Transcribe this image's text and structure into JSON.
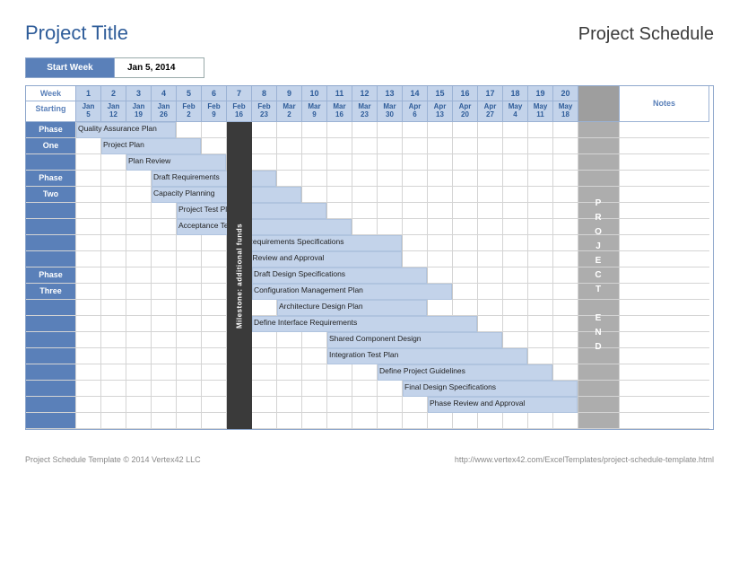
{
  "title": "Project Title",
  "subhead": "Project Schedule",
  "start_week_label": "Start Week",
  "start_week_value": "Jan 5, 2014",
  "header": {
    "week_label": "Week",
    "starting_label": "Starting",
    "notes_label": "Notes",
    "weeks": [
      1,
      2,
      3,
      4,
      5,
      6,
      7,
      8,
      9,
      10,
      11,
      12,
      13,
      14,
      15,
      16,
      17,
      18,
      19,
      20
    ],
    "dates": [
      "Jan 5",
      "Jan 12",
      "Jan 19",
      "Jan 26",
      "Feb 2",
      "Feb 9",
      "Feb 16",
      "Feb 23",
      "Mar 2",
      "Mar 9",
      "Mar 16",
      "Mar 23",
      "Mar 30",
      "Apr 6",
      "Apr 13",
      "Apr 20",
      "Apr 27",
      "May 4",
      "May 11",
      "May 18"
    ]
  },
  "phases": [
    {
      "name": "Phase One",
      "row_start": 0,
      "row_span": 3
    },
    {
      "name": "Phase Two",
      "row_start": 3,
      "row_span": 6
    },
    {
      "name": "Phase Three",
      "row_start": 9,
      "row_span": 10
    }
  ],
  "tasks": [
    {
      "row": 0,
      "start": 1,
      "span": 4,
      "label": "Quality Assurance Plan"
    },
    {
      "row": 1,
      "start": 2,
      "span": 4,
      "label": "Project Plan"
    },
    {
      "row": 2,
      "start": 3,
      "span": 4,
      "label": "Plan Review"
    },
    {
      "row": 3,
      "start": 4,
      "span": 5,
      "label": "Draft Requirements"
    },
    {
      "row": 4,
      "start": 4,
      "span": 6,
      "label": "Capacity Planning"
    },
    {
      "row": 5,
      "start": 5,
      "span": 6,
      "label": "Project Test Plan"
    },
    {
      "row": 6,
      "start": 5,
      "span": 7,
      "label": "Acceptance Test Plan"
    },
    {
      "row": 7,
      "start": 7,
      "span": 7,
      "label": "Final Requirements Specifications"
    },
    {
      "row": 8,
      "start": 7,
      "span": 7,
      "label": "Phase Review and Approval"
    },
    {
      "row": 9,
      "start": 8,
      "span": 7,
      "label": "Draft Design Specifications"
    },
    {
      "row": 10,
      "start": 8,
      "span": 8,
      "label": "Configuration Management Plan"
    },
    {
      "row": 11,
      "start": 9,
      "span": 6,
      "label": "Architecture Design Plan"
    },
    {
      "row": 12,
      "start": 8,
      "span": 9,
      "label": "Define Interface Requirements"
    },
    {
      "row": 13,
      "start": 11,
      "span": 7,
      "label": "Shared Component Design"
    },
    {
      "row": 14,
      "start": 11,
      "span": 8,
      "label": "Integration Test Plan"
    },
    {
      "row": 15,
      "start": 13,
      "span": 7,
      "label": "Define Project Guidelines"
    },
    {
      "row": 16,
      "start": 14,
      "span": 7,
      "label": "Final Design Specifications"
    },
    {
      "row": 17,
      "start": 15,
      "span": 6,
      "label": "Phase Review and Approval"
    }
  ],
  "milestone": {
    "label": "Milestone: additional funds",
    "col": 7,
    "row_start": 0,
    "row_span": 19
  },
  "project_end": "PROJECT END",
  "total_rows": 19,
  "footer_left": "Project Schedule Template © 2014 Vertex42 LLC",
  "footer_right": "http://www.vertex42.com/ExcelTemplates/project-schedule-template.html",
  "chart_data": {
    "type": "gantt",
    "title": "Project Schedule",
    "start_date": "Jan 5, 2014",
    "weeks": 20,
    "x_labels": [
      "Jan 5",
      "Jan 12",
      "Jan 19",
      "Jan 26",
      "Feb 2",
      "Feb 9",
      "Feb 16",
      "Feb 23",
      "Mar 2",
      "Mar 9",
      "Mar 16",
      "Mar 23",
      "Mar 30",
      "Apr 6",
      "Apr 13",
      "Apr 20",
      "Apr 27",
      "May 4",
      "May 11",
      "May 18"
    ],
    "series": [
      {
        "phase": "Phase One",
        "task": "Quality Assurance Plan",
        "start_week": 1,
        "duration_weeks": 4
      },
      {
        "phase": "Phase One",
        "task": "Project Plan",
        "start_week": 2,
        "duration_weeks": 4
      },
      {
        "phase": "Phase One",
        "task": "Plan Review",
        "start_week": 3,
        "duration_weeks": 4
      },
      {
        "phase": "Phase Two",
        "task": "Draft Requirements",
        "start_week": 4,
        "duration_weeks": 5
      },
      {
        "phase": "Phase Two",
        "task": "Capacity Planning",
        "start_week": 4,
        "duration_weeks": 6
      },
      {
        "phase": "Phase Two",
        "task": "Project Test Plan",
        "start_week": 5,
        "duration_weeks": 6
      },
      {
        "phase": "Phase Two",
        "task": "Acceptance Test Plan",
        "start_week": 5,
        "duration_weeks": 7
      },
      {
        "phase": "Phase Two",
        "task": "Final Requirements Specifications",
        "start_week": 7,
        "duration_weeks": 7
      },
      {
        "phase": "Phase Two",
        "task": "Phase Review and Approval",
        "start_week": 7,
        "duration_weeks": 7
      },
      {
        "phase": "Phase Three",
        "task": "Draft Design Specifications",
        "start_week": 8,
        "duration_weeks": 7
      },
      {
        "phase": "Phase Three",
        "task": "Configuration Management Plan",
        "start_week": 8,
        "duration_weeks": 8
      },
      {
        "phase": "Phase Three",
        "task": "Architecture Design Plan",
        "start_week": 9,
        "duration_weeks": 6
      },
      {
        "phase": "Phase Three",
        "task": "Define Interface Requirements",
        "start_week": 8,
        "duration_weeks": 9
      },
      {
        "phase": "Phase Three",
        "task": "Shared Component Design",
        "start_week": 11,
        "duration_weeks": 7
      },
      {
        "phase": "Phase Three",
        "task": "Integration Test Plan",
        "start_week": 11,
        "duration_weeks": 8
      },
      {
        "phase": "Phase Three",
        "task": "Define Project Guidelines",
        "start_week": 13,
        "duration_weeks": 7
      },
      {
        "phase": "Phase Three",
        "task": "Final Design Specifications",
        "start_week": 14,
        "duration_weeks": 7
      },
      {
        "phase": "Phase Three",
        "task": "Phase Review and Approval",
        "start_week": 15,
        "duration_weeks": 6
      }
    ],
    "milestones": [
      {
        "label": "Milestone: additional funds",
        "week": 7
      }
    ],
    "end_marker": "PROJECT END"
  }
}
